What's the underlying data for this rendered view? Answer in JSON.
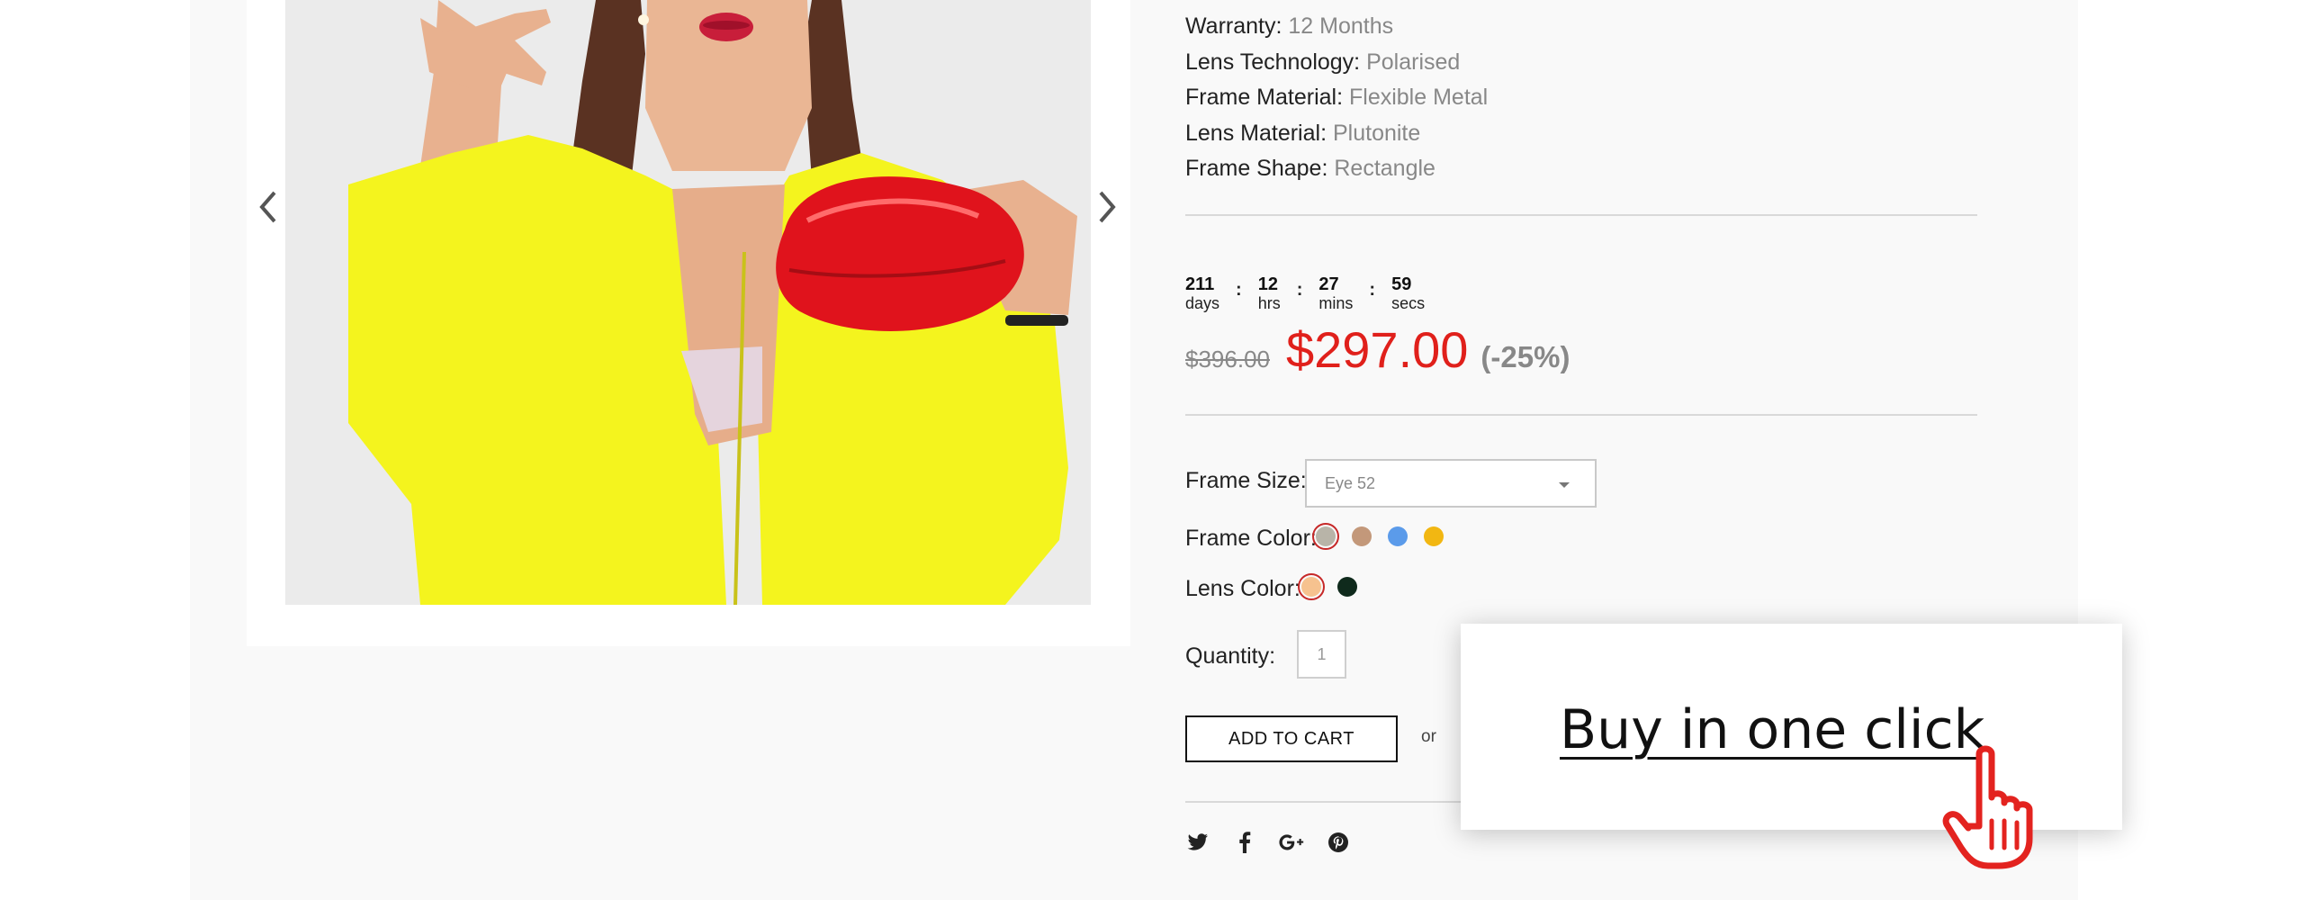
{
  "specs": [
    {
      "label": "Warranty:",
      "value": "12 Months"
    },
    {
      "label": "Lens Technology:",
      "value": "Polarised"
    },
    {
      "label": "Frame Material:",
      "value": "Flexible Metal"
    },
    {
      "label": "Lens Material:",
      "value": "Plutonite"
    },
    {
      "label": "Frame Shape:",
      "value": "Rectangle"
    }
  ],
  "countdown": {
    "days": "211",
    "days_label": "days",
    "hrs": "12",
    "hrs_label": "hrs",
    "mins": "27",
    "mins_label": "mins",
    "secs": "59",
    "secs_label": "secs",
    "separator": ":"
  },
  "price": {
    "old": "$396.00",
    "new": "$297.00",
    "discount": "(-25%)"
  },
  "options": {
    "frame_size_label": "Frame Size:",
    "frame_size_value": "Eye 52",
    "frame_color_label": "Frame Color:",
    "frame_colors": [
      "#b8b4a8",
      "#c3987a",
      "#5b9bea",
      "#f2b712"
    ],
    "frame_color_selected": 0,
    "lens_color_label": "Lens Color:",
    "lens_colors": [
      "#f6c28f",
      "#0f2a1c"
    ],
    "lens_color_selected": 0,
    "quantity_label": "Quantity:",
    "quantity_value": "1"
  },
  "actions": {
    "add_to_cart": "ADD TO CART",
    "or": "or"
  },
  "popup": {
    "buy_one_click": "Buy in one click"
  },
  "social": [
    "twitter-icon",
    "facebook-icon",
    "google-plus-icon",
    "pinterest-icon"
  ],
  "colors": {
    "accent_red": "#e0201b",
    "jacket_yellow": "#f4f41e"
  }
}
